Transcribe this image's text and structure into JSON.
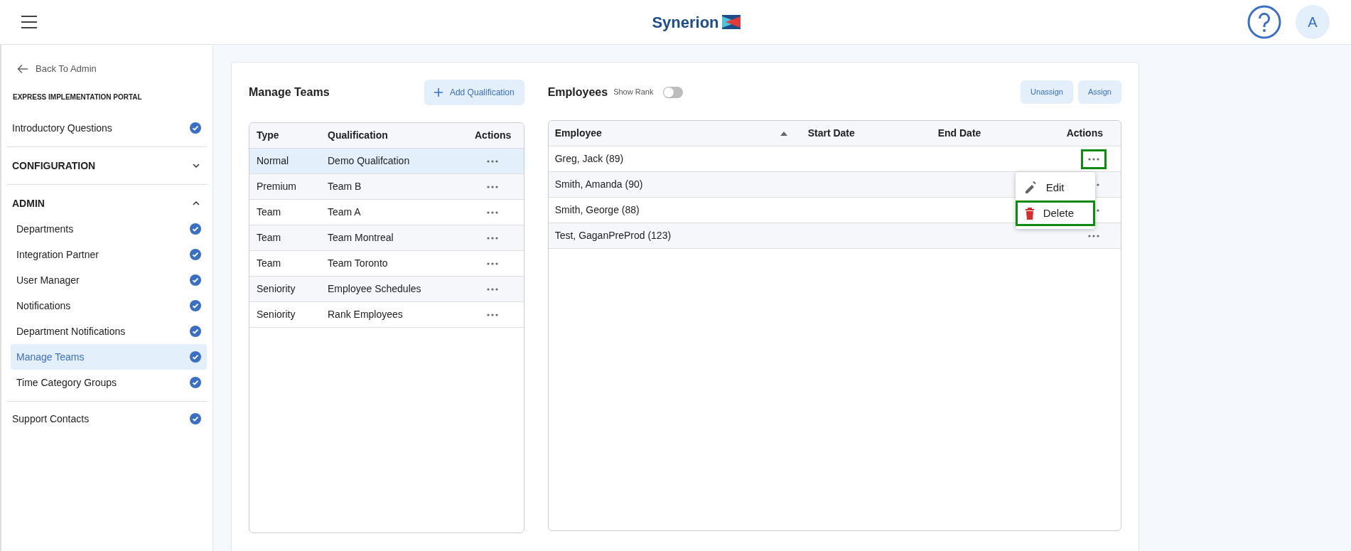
{
  "header": {
    "logo_text": "Synerion",
    "avatar": "A"
  },
  "sidebar": {
    "back_link": "Back To Admin",
    "portal_title": "EXPRESS IMPLEMENTATION PORTAL",
    "sections": [
      {
        "kind": "item",
        "label": "Introductory Questions",
        "done": true
      },
      {
        "kind": "group",
        "label": "CONFIGURATION",
        "expanded": false
      },
      {
        "kind": "group",
        "label": "ADMIN",
        "expanded": true,
        "children": [
          {
            "label": "Departments",
            "done": true,
            "selected": false
          },
          {
            "label": "Integration Partner",
            "done": true,
            "selected": false
          },
          {
            "label": "User Manager",
            "done": true,
            "selected": false
          },
          {
            "label": "Notifications",
            "done": true,
            "selected": false
          },
          {
            "label": "Department Notifications",
            "done": true,
            "selected": false
          },
          {
            "label": "Manage Teams",
            "done": true,
            "selected": true
          },
          {
            "label": "Time Category Groups",
            "done": true,
            "selected": false
          }
        ]
      },
      {
        "kind": "item",
        "label": "Support Contacts",
        "done": true
      }
    ]
  },
  "teams": {
    "title": "Manage Teams",
    "add_button": "Add Qualification",
    "columns": [
      "Type",
      "Qualification",
      "Actions"
    ],
    "rows": [
      {
        "type": "Normal",
        "qualification": "Demo Qualifcation",
        "selected": true
      },
      {
        "type": "Premium",
        "qualification": "Team B",
        "selected": false
      },
      {
        "type": "Team",
        "qualification": "Team A",
        "selected": false
      },
      {
        "type": "Team",
        "qualification": "Team Montreal",
        "selected": false
      },
      {
        "type": "Team",
        "qualification": "Team Toronto",
        "selected": false
      },
      {
        "type": "Seniority",
        "qualification": "Employee Schedules",
        "selected": false
      },
      {
        "type": "Seniority",
        "qualification": "Rank Employees",
        "selected": false
      }
    ]
  },
  "employees": {
    "title": "Employees",
    "show_rank": {
      "label": "Show Rank",
      "on": false
    },
    "buttons": [
      "Unassign",
      "Assign"
    ],
    "columns": [
      "Employee",
      "Start Date",
      "End Date",
      "Actions"
    ],
    "rows": [
      {
        "employee": "Greg, Jack (89)",
        "highlighted": true
      },
      {
        "employee": "Smith, Amanda (90)",
        "highlighted": false
      },
      {
        "employee": "Smith, George (88)",
        "highlighted": false
      },
      {
        "employee": "Test, GaganPreProd (123)",
        "highlighted": false
      }
    ],
    "menu": [
      {
        "kind": "edit",
        "label": "Edit",
        "highlighted": false
      },
      {
        "kind": "delete",
        "label": "Delete",
        "highlighted": true
      }
    ]
  }
}
